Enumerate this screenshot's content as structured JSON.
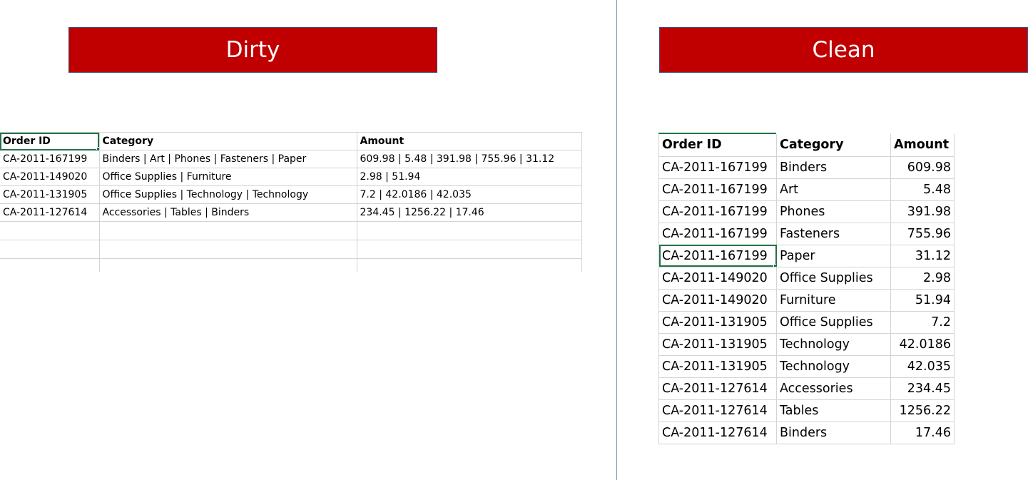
{
  "dirty": {
    "banner": "Dirty",
    "headers": [
      "Order ID",
      "Category",
      "Amount"
    ],
    "rows": [
      [
        "CA-2011-167199",
        "Binders | Art | Phones | Fasteners | Paper",
        "609.98 | 5.48 | 391.98 | 755.96 | 31.12"
      ],
      [
        "CA-2011-149020",
        "Office Supplies | Furniture",
        "2.98 | 51.94"
      ],
      [
        "CA-2011-131905",
        "Office Supplies | Technology | Technology",
        "7.2 | 42.0186 | 42.035"
      ],
      [
        "CA-2011-127614",
        "Accessories | Tables | Binders",
        "234.45 | 1256.22 | 17.46"
      ]
    ]
  },
  "clean": {
    "banner": "Clean",
    "headers": [
      "Order ID",
      "Category",
      "Amount"
    ],
    "rows": [
      [
        "CA-2011-167199",
        "Binders",
        "609.98"
      ],
      [
        "CA-2011-167199",
        "Art",
        "5.48"
      ],
      [
        "CA-2011-167199",
        "Phones",
        "391.98"
      ],
      [
        "CA-2011-167199",
        "Fasteners",
        "755.96"
      ],
      [
        "CA-2011-167199",
        "Paper",
        "31.12"
      ],
      [
        "CA-2011-149020",
        "Office Supplies",
        "2.98"
      ],
      [
        "CA-2011-149020",
        "Furniture",
        "51.94"
      ],
      [
        "CA-2011-131905",
        "Office Supplies",
        "7.2"
      ],
      [
        "CA-2011-131905",
        "Technology",
        "42.0186"
      ],
      [
        "CA-2011-131905",
        "Technology",
        "42.035"
      ],
      [
        "CA-2011-127614",
        "Accessories",
        "234.45"
      ],
      [
        "CA-2011-127614",
        "Tables",
        "1256.22"
      ],
      [
        "CA-2011-127614",
        "Binders",
        "17.46"
      ]
    ]
  },
  "colors": {
    "banner_bg": "#c00000",
    "selection": "#217346",
    "gridline": "#d4d4d4"
  }
}
